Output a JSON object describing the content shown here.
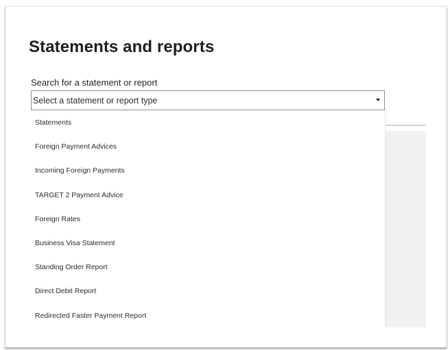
{
  "page": {
    "title": "Statements and reports"
  },
  "search": {
    "label": "Search for a statement or report",
    "placeholder": "Select a statement or report type"
  },
  "dropdown": {
    "items": [
      {
        "label": "Statements"
      },
      {
        "label": "Foreign Payment Advices"
      },
      {
        "label": "Incoming Foreign Payments"
      },
      {
        "label": "TARGET 2 Payment Advice"
      },
      {
        "label": "Foreign Rates"
      },
      {
        "label": "Business Visa Statement"
      },
      {
        "label": "Standing Order Report"
      },
      {
        "label": "Direct Debit Report"
      },
      {
        "label": "Redirected Faster Payment Report"
      }
    ]
  },
  "icons": {
    "dropdown_caret": "caret-down-icon"
  },
  "colors": {
    "text": "#1f1f1f",
    "border": "#8d8d8d",
    "panel_background": "#f1f1f1"
  }
}
